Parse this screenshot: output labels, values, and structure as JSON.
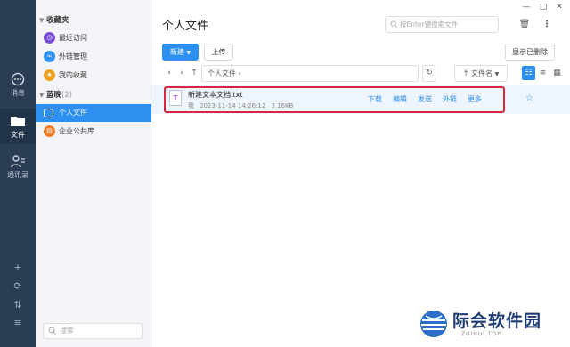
{
  "rail": {
    "items": [
      {
        "label": "消息",
        "icon": "chat-bubble-icon"
      },
      {
        "label": "文件",
        "icon": "folder-icon"
      },
      {
        "label": "通讯录",
        "icon": "contacts-icon"
      }
    ],
    "bottom_icons": [
      "plus-icon",
      "sync-icon",
      "transfer-icon",
      "menu-icon"
    ]
  },
  "nav": {
    "favorites_label": "收藏夹",
    "favorites": [
      {
        "label": "最近访问",
        "color": "#7b4fd6",
        "icon": "recent-icon"
      },
      {
        "label": "外链管理",
        "color": "#2d8ff0",
        "icon": "link-icon"
      },
      {
        "label": "我的收藏",
        "color": "#f0a020",
        "icon": "star-icon"
      }
    ],
    "group_label": "蓝晚",
    "group_count": "(2)",
    "group_items": [
      {
        "label": "个人文件",
        "color": "#2d8ff0",
        "icon": "folder-icon"
      },
      {
        "label": "企业公共库",
        "color": "#f07c28",
        "icon": "library-icon"
      }
    ],
    "search_placeholder": "搜索"
  },
  "main": {
    "title": "个人文件",
    "search_placeholder": "按Enter键搜索文件",
    "new_label": "新建",
    "upload_label": "上传",
    "show_deleted_label": "显示已删除",
    "path": "个人文件",
    "sort_label": "文件名",
    "file": {
      "name": "新建文本文档.txt",
      "owner": "我",
      "time": "2023-11-14 14:26:12",
      "size": "3.16KB",
      "icon_letter": "T"
    },
    "actions": [
      "下载",
      "编辑",
      "发送",
      "外链",
      "更多"
    ]
  },
  "watermark": {
    "text": "际会软件园",
    "sub": "ZUIHUI.TOP"
  },
  "colors": {
    "accent": "#2d8ff0",
    "highlight": "#d7263d",
    "rail": "#2b3d55"
  }
}
